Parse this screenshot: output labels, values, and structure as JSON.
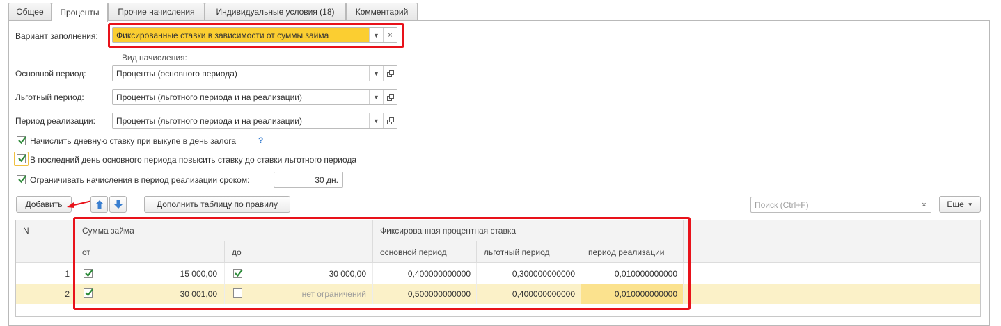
{
  "tabs": [
    {
      "label": "Общее"
    },
    {
      "label": "Проценты"
    },
    {
      "label": "Прочие начисления"
    },
    {
      "label": "Индивидуальные условия (18)"
    },
    {
      "label": "Комментарий"
    }
  ],
  "form": {
    "fill_variant_label": "Вариант заполнения:",
    "fill_variant_value": "Фиксированные ставки в зависимости от суммы займа",
    "accrual_type_label": "Вид начисления:",
    "main_period_label": "Основной период:",
    "main_period_value": "Проценты (основного периода)",
    "grace_period_label": "Льготный период:",
    "grace_period_value": "Проценты (льготного периода и на реализации)",
    "sale_period_label": "Период реализации:",
    "sale_period_value": "Проценты (льготного периода и на реализации)"
  },
  "options": {
    "daily_rate_label": "Начислить дневную ставку при выкупе в день залога",
    "daily_rate_help": "?",
    "raise_rate_label": "В последний день основного периода повысить ставку до ставки льготного периода",
    "limit_label": "Ограничивать начисления в период реализации сроком:",
    "limit_value": "30 дн."
  },
  "toolbar": {
    "add_label": "Добавить",
    "fill_by_rule_label": "Дополнить таблицу по правилу",
    "search_placeholder": "Поиск (Ctrl+F)",
    "more_label": "Еще"
  },
  "table": {
    "col_n": "N",
    "group_amount": "Сумма займа",
    "col_from": "от",
    "col_to": "до",
    "group_rate": "Фиксированная процентная ставка",
    "col_main": "основной период",
    "col_grace": "льготный период",
    "col_sale": "период реализации",
    "rows": [
      {
        "n": "1",
        "from": "15 000,00",
        "to": "30 000,00",
        "main": "0,400000000000",
        "grace": "0,300000000000",
        "sale": "0,010000000000"
      },
      {
        "n": "2",
        "from": "30 001,00",
        "to": "нет ограничений",
        "main": "0,500000000000",
        "grace": "0,400000000000",
        "sale": "0,010000000000"
      }
    ]
  },
  "colors": {
    "highlight_red": "#e8121a",
    "field_yellow": "#fbce31",
    "selected_row": "#fbf1c8",
    "selected_cell": "#fbe28e",
    "check_green": "#2e8b3a",
    "arrow_blue": "#3a7fd0"
  }
}
